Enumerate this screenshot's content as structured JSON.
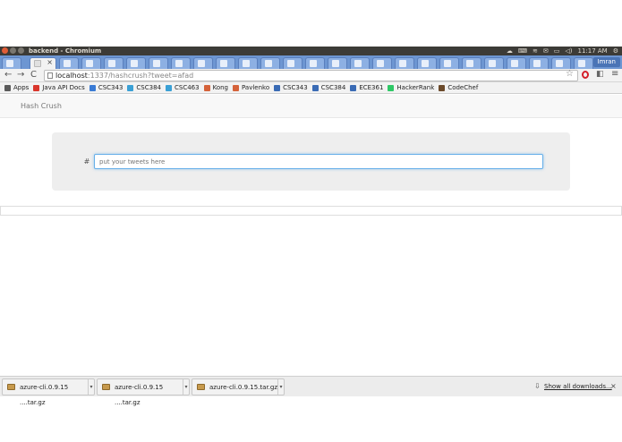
{
  "window": {
    "title": "backend - Chromium",
    "clock": "11:17 AM",
    "user": "Imran"
  },
  "tabs": {
    "active_close": "×"
  },
  "toolbar": {
    "back": "←",
    "forward": "→",
    "reload": "C",
    "url_host": "localhost",
    "url_path": ":1337/hashcrush?tweet=afad",
    "star": "☆",
    "menu": "≡"
  },
  "bookmarks": [
    {
      "label": "Apps",
      "color": "#5a5a5a"
    },
    {
      "label": "Java API Docs",
      "color": "#d9352b"
    },
    {
      "label": "CSC343",
      "color": "#3a7bd5"
    },
    {
      "label": "CSC384",
      "color": "#3aa0d5"
    },
    {
      "label": "CSC463",
      "color": "#3aa0d5"
    },
    {
      "label": "Kong",
      "color": "#d5623a"
    },
    {
      "label": "Pavlenko",
      "color": "#d5623a"
    },
    {
      "label": "CSC343",
      "color": "#3a6bb5"
    },
    {
      "label": "CSC384",
      "color": "#3a6bb5"
    },
    {
      "label": "ECE361",
      "color": "#3a6bb5"
    },
    {
      "label": "HackerRank",
      "color": "#2ec866"
    },
    {
      "label": "CodeChef",
      "color": "#6b4a2b"
    }
  ],
  "app": {
    "brand": "Hash Crush",
    "addon": "#",
    "input_placeholder": "put your tweets here"
  },
  "downloads": {
    "items": [
      "azure-cli.0.9.15 ....tar.gz",
      "azure-cli.0.9.15 ....tar.gz",
      "azure-cli.0.9.15.tar.gz"
    ],
    "show_all": "Show all downloads...",
    "close": "×"
  }
}
